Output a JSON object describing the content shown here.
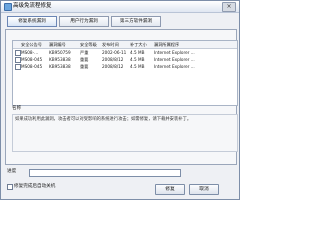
{
  "window": {
    "title": "高级免流程修复",
    "close_symbol": "×"
  },
  "tabs": [
    {
      "label": "修复系统漏洞",
      "active": true
    },
    {
      "label": "用户行为漏洞",
      "active": false
    },
    {
      "label": "第三方软件漏洞",
      "active": false
    }
  ],
  "list": {
    "headers": [
      "安全公告号",
      "漏洞编号",
      "安全等级",
      "发布时间",
      "补丁大小",
      "漏洞所属程序"
    ],
    "rows": [
      {
        "id": "MS08-...",
        "kb": "KB950759",
        "level": "严重",
        "date": "2002-06-11",
        "size": "4.5 MB",
        "program": "Internet Explorer ..."
      },
      {
        "id": "MS08-045",
        "kb": "KB953838",
        "level": "重要",
        "date": "2008/8/12",
        "size": "4.5 MB",
        "program": "Internet Explorer ..."
      },
      {
        "id": "MS08-045",
        "kb": "KB953838",
        "level": "重要",
        "date": "2008/8/12",
        "size": "4.5 MB",
        "program": "Internet Explorer ..."
      }
    ]
  },
  "details": {
    "name_label": "名称",
    "description": "如果成功利用此漏洞，攻击者可以对受影响的系统进行攻击；如需修复，请下载并安装补丁。"
  },
  "progress": {
    "label": "进度",
    "value_percent": 0
  },
  "bottom": {
    "auto_close_label": "修复完成后自动关机",
    "repair_button": "修复",
    "cancel_button": "取消"
  }
}
